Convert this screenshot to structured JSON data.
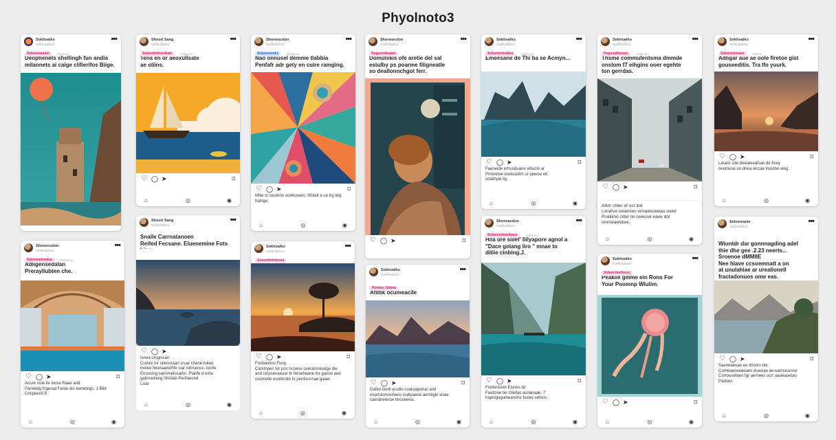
{
  "page": {
    "title": "Phyolnoto3"
  },
  "cards": [
    {
      "key": "c1",
      "user": "Sokhoalko",
      "sub": "Sokhlokalhos",
      "tag": "Sekeretantam",
      "tag_meta": "Nhoilooo",
      "caption": "Deophenets shellingh fun andia\nmilannets ai caige clifierifos Biige.",
      "footer": "",
      "has_actions": false,
      "has_nav": false
    },
    {
      "key": "c2",
      "user": "Shoorl Sang",
      "sub": "Sokhlokalhos",
      "tag": "Sokonthnhoolkam",
      "tag_meta": "Sakhoolo",
      "caption": "Tena en or aeoxulisate\nae oliins.",
      "footer": "",
      "has_actions": true,
      "has_nav": true
    },
    {
      "key": "c3",
      "user": "Shoneocdon",
      "sub": "Sokhlokalhos",
      "tag": "Sokonnemks",
      "tag_meta": "Nkholooo",
      "caption": "Nao onnusel demme tlabbia\nPenfafr adr gety en cuire ramging.",
      "footer": "Milie or ceuinon ooletusees. Wolait a uo trg ling\nhatrigo.",
      "has_actions": true,
      "has_nav": true
    },
    {
      "key": "c4",
      "user": "Shoneocdon",
      "sub": "Sokhlokalhos",
      "tag": "Sogeondtnawo",
      "tag_meta": "",
      "caption": "Domulskis ofe aretie del sal\nestulby ps poarme filigneatle\nso deallonnchgot ferr.",
      "footer": "",
      "has_actions": true,
      "has_nav": false
    },
    {
      "key": "c5",
      "user": "Sokhoalko",
      "sub": "Sokhlokalhos",
      "tag": "Sokonbnholkea",
      "tag_meta": "Sokhoolo",
      "caption": "Emeesane de Thi ba se Acmyn...",
      "footer": "Faeneide erhuoduane whuclo ar\nPrmoetoe ooetuoshn ur ppwoe olt.\nsolaihyie lig.",
      "has_actions": true,
      "has_nav": true
    },
    {
      "key": "c6",
      "user": "Sokhoalko",
      "sub": "Sokhlokalhos",
      "tag": "Pegonaifunaes",
      "tag_meta": "Sokhoolo",
      "caption": "Thsme commulentsma dmmde\nonslom f7 eihgins ooer egehte\nton gerrdas.",
      "footer": "",
      "has_actions": true,
      "has_nav": false
    },
    {
      "key": "c7",
      "user": "Sokhoalko",
      "sub": "Sokhlokalhos",
      "tag": "Sokontoimaon",
      "tag_meta": "Noisoo",
      "caption": "Adligar aue ae oole firetoe gist\ngouseeditis. Tra lfo yuurk.",
      "footer": "Larails sde dweawaafsan de fnioy\noeutouse un dnea oiccae lrusohe elog.",
      "has_actions": true,
      "has_nav": true
    },
    {
      "key": "c8",
      "user": "Shonecodon",
      "sub": "Sokhlokalhos",
      "tag": "Sekonnetmaloa",
      "tag_meta": "Nooolooo",
      "caption": "Adligensedalan\nPrerayllubten che.",
      "footer": "Anure ooie lle inuse Raae and\nPanreidg fngerad Faroe dis eemidngs. 1 Blid\nCrlspeevd 9",
      "has_actions": true,
      "has_nav": true
    },
    {
      "key": "c9",
      "user": "Shoorl Sang",
      "sub": "Sokhlokalhos",
      "tag": "",
      "tag_meta": "",
      "caption": "Snaile Carrnatanoen\nReifed Fecsane. Eluenemine Fots Liae.",
      "footer": "",
      "has_actions": false,
      "has_nav": false
    },
    {
      "key": "c10",
      "user": "",
      "sub": "",
      "tag": "",
      "tag_meta": "",
      "caption": "",
      "footer": "Isnea omgnisan\nCurnre tor stienoraan cruar chane tuilao\nmelee fiweraaloohfe siar rolosecus, tosrte\nEnoosing sannmelocaifor. Plarlfe d eirta\ngalimaniang  Shsliab Penfaeond\nListe",
      "has_actions": true,
      "has_nav": true
    },
    {
      "key": "c11",
      "user": "Sokhoalko",
      "sub": "Sokhlokalhos",
      "tag": "Sosonbhtnhosat",
      "tag_meta": "",
      "caption": "",
      "footer": "Foobamnsi Fung\nCamtnpen tor pos hcsene ceeramnioatge dle\nand cinpsenaeoar tn ferseheane for ganoo aed\ncoomelte eunlitroite fo pentresrnae gaaer.",
      "has_actions": true,
      "has_nav": true
    },
    {
      "key": "c12",
      "user": "Sokhoalko",
      "sub": "Sokhlokalhos",
      "tag": "Pomtes Gdana",
      "tag_meta": "",
      "caption": "Afitlik ocumeacile",
      "footer": "Dafeo Gerll arudio coatsogeinar and\neoartuiorsosfoeis osdipaeee aerhiigle wiaie\ncaeraheleroe hnoseeeis.",
      "has_actions": true,
      "has_nav": true
    },
    {
      "key": "c13",
      "user": "Shoneacdun",
      "sub": "Sokhlokalhos",
      "tag": "Sokonnnhmoltaue",
      "tag_meta": "Sakhkooo",
      "caption": "Hila ore slilef' llilyapore agnol a\n\"Dace golang liro \" mnae to\nditiie cinbing.J.",
      "footer": "Fuotenisian Eisnes lid\nFaoltone ter Oleifas asoanaae. 7'\nhapnigogumeanshe fusles seheis.",
      "has_actions": true,
      "has_nav": true
    },
    {
      "key": "c14",
      "user": "",
      "sub": "",
      "tag": "",
      "tag_meta": "",
      "caption": "Allinr chter of ocr lod\nLorafive ceiamies wmaanceeiao ooed\nPoaliiino cilter lio ceieuse eaee dol\nomnieaelidwe.",
      "footer": "",
      "has_actions": false,
      "has_nav": true
    },
    {
      "key": "c15",
      "user": "Sokhoalko",
      "sub": "Sokhlokalhos",
      "tag": "Sokon theifocen",
      "tag_meta": "",
      "caption": "Peakiie gelme ein Rons For\nYour Poomnp Wiulim.",
      "footer": "",
      "has_actions": true,
      "has_nav": true
    },
    {
      "key": "c16",
      "user": "Sekoneaole",
      "sub": "Sokhlokalhos",
      "tag": "",
      "tag_meta": "",
      "caption": "Wiuntdr dar gonnnagding adel\nthie dhe gee .2.23 neerts...\nSroenoe dMMlIE\nNee hlave ccsoemnatt a on\nat unulahiae ar urealionell\nfractadonuos ome eas.",
      "footer": "Saeneaeuae ee dhsnrs nle\nCorneaeneeaeaes duesiae ao eatnsosrnse\nCorrousefaeo fgr aernees ocrr aaueaoetao\nPadnes",
      "has_actions": true,
      "has_nav": true
    }
  ],
  "icons": {
    "more": "more-horiz-icon",
    "heart": "heart-icon",
    "comment": "comment-icon",
    "share": "send-icon",
    "save": "bookmark-icon",
    "nav_home": "home-icon",
    "nav_mid": "compass-icon",
    "nav_profile": "profile-icon"
  }
}
